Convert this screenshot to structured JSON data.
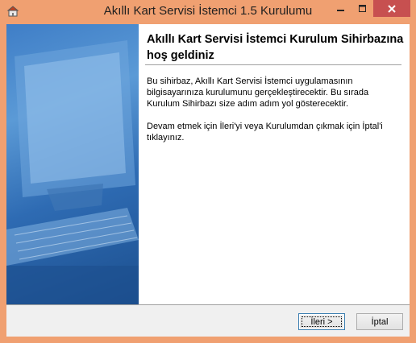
{
  "window": {
    "title": "Akıllı Kart Servisi İstemci 1.5 Kurulumu",
    "icons": [
      "app-icon",
      "minimize-icon",
      "maximize-icon",
      "close-icon"
    ]
  },
  "content": {
    "heading": "Akıllı Kart Servisi İstemci Kurulum Sihirbazına hoş geldiniz",
    "paragraph1": "Bu sihirbaz, Akıllı Kart Servisi İstemci uygulamasının bilgisayarınıza kurulumunu gerçekleştirecektir. Bu sırada Kurulum Sihirbazı size adım adım yol gösterecektir.",
    "paragraph2": "Devam etmek için İleri'yi veya Kurulumdan çıkmak için İptal'i tıklayınız."
  },
  "buttons": {
    "next_label": "İleri >",
    "cancel_label": "İptal"
  },
  "colors": {
    "titlebar": "#f0a071",
    "close_button": "#c75050",
    "side_panel": "#3f7ec7"
  }
}
